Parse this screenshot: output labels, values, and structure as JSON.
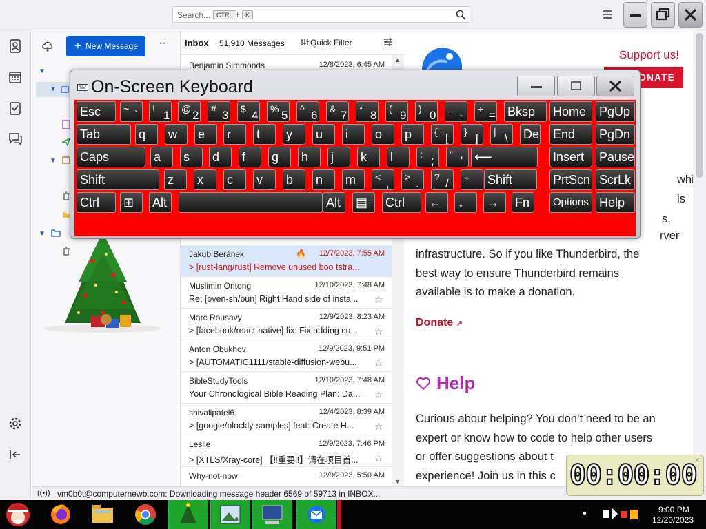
{
  "search": {
    "placeholder": "Search...",
    "kbd1": "CTRL",
    "plus": "+",
    "kbd2": "K"
  },
  "folder_pane": {
    "new_message": "New Message"
  },
  "list_header": {
    "title": "Inbox",
    "count": "51,910 Messages",
    "quick_filter": "Quick Filter"
  },
  "messages": [
    {
      "from": "Benjamin Simmonds",
      "date": "12/8/2023, 6:45 AM",
      "subject": ""
    },
    {
      "from": "Jakub Beránek",
      "date": "12/7/2023, 7:55 AM",
      "subject": "[rust-lang/rust] Remove unused boo tstra..."
    },
    {
      "from": "Muslimin Ontong",
      "date": "12/10/2023, 7:48 AM",
      "subject": "Re: [oven-sh/bun] Right Hand side of insta..."
    },
    {
      "from": "Marc Rousavy",
      "date": "12/9/2023, 8:23 AM",
      "subject": "[facebook/react-native] fix: Fix adding cu..."
    },
    {
      "from": "Anton Obukhov",
      "date": "12/9/2023, 9:51 PM",
      "subject": "[AUTOMATIC1111/stable-diffusion-webu..."
    },
    {
      "from": "BibleStudyTools",
      "date": "12/10/2023, 7:48 AM",
      "subject": "Your Chronological Bible Reading Plan: Da..."
    },
    {
      "from": "shivalipatel6",
      "date": "12/4/2023, 8:39 AM",
      "subject": "[google/blockly-samples] feat: Create H..."
    },
    {
      "from": "Leslie",
      "date": "12/9/2023, 7:46 PM",
      "subject": "[XTLS/Xray-core] 【‼重要‼】请在项目首..."
    },
    {
      "from": "Why-not-now",
      "date": "12/9/2023, 5:50 AM",
      "subject": ""
    }
  ],
  "content": {
    "support": "Support us!",
    "donate_button": "DONATE",
    "frag_which": "which is",
    "frag_s": "s,",
    "frag_rver": "rver",
    "para1": [
      "infrastructure. So if you like Thunderbird, the",
      "best way to ensure Thunderbird remains",
      "available is to make a donation."
    ],
    "donate_link": "Donate",
    "help_heading": "Help",
    "para2": [
      "Curious about helping? You don’t need to be an",
      "expert or know how to code to help other users",
      "or offer suggestions about t",
      "experience! Join us in this c"
    ]
  },
  "status": "vm0b0t@computernewb.com: Downloading message header 6569 of 59713 in INBOX...",
  "osk": {
    "title": "On-Screen Keyboard",
    "rows": [
      [
        {
          "l": "Esc"
        },
        {
          "t": "~",
          "b": "`"
        },
        {
          "t": "!",
          "b": "1"
        },
        {
          "t": "@",
          "b": "2"
        },
        {
          "t": "#",
          "b": "3"
        },
        {
          "t": "$",
          "b": "4"
        },
        {
          "t": "%",
          "b": "5"
        },
        {
          "t": "^",
          "b": "6"
        },
        {
          "t": "&",
          "b": "7"
        },
        {
          "t": "*",
          "b": "8"
        },
        {
          "t": "(",
          "b": "9"
        },
        {
          "t": ")",
          "b": "0"
        },
        {
          "t": "_",
          "b": "-"
        },
        {
          "t": "+",
          "b": "="
        },
        {
          "l": "Bksp"
        },
        {
          "l": "Home"
        },
        {
          "l": "PgUp"
        }
      ],
      [
        {
          "l": "Tab"
        },
        {
          "l": "q"
        },
        {
          "l": "w"
        },
        {
          "l": "e"
        },
        {
          "l": "r"
        },
        {
          "l": "t"
        },
        {
          "l": "y"
        },
        {
          "l": "u"
        },
        {
          "l": "i"
        },
        {
          "l": "o"
        },
        {
          "l": "p"
        },
        {
          "t": "{",
          "b": "["
        },
        {
          "t": "}",
          "b": "]"
        },
        {
          "t": "|",
          "b": "\\"
        },
        {
          "l": "Del"
        },
        {
          "l": "End"
        },
        {
          "l": "PgDn"
        }
      ],
      [
        {
          "l": "Caps"
        },
        {
          "l": "a"
        },
        {
          "l": "s"
        },
        {
          "l": "d"
        },
        {
          "l": "f"
        },
        {
          "l": "g"
        },
        {
          "l": "h"
        },
        {
          "l": "j"
        },
        {
          "l": "k"
        },
        {
          "l": "l"
        },
        {
          "t": ":",
          "b": ";"
        },
        {
          "t": "\"",
          "b": "'"
        },
        {
          "l": "⟵"
        },
        {
          "l": "Insert"
        },
        {
          "l": "Pause"
        }
      ],
      [
        {
          "l": "Shift"
        },
        {
          "l": "z"
        },
        {
          "l": "x"
        },
        {
          "l": "c"
        },
        {
          "l": "v"
        },
        {
          "l": "b"
        },
        {
          "l": "n"
        },
        {
          "l": "m"
        },
        {
          "t": "<",
          "b": ","
        },
        {
          "t": ">",
          "b": "."
        },
        {
          "t": "?",
          "b": "/"
        },
        {
          "l": "↑"
        },
        {
          "l": "Shift"
        },
        {
          "l": "PrtScn"
        },
        {
          "l": "ScrLk"
        }
      ],
      [
        {
          "l": "Ctrl"
        },
        {
          "l": "⊞"
        },
        {
          "l": "Alt"
        },
        {
          "l": ""
        },
        {
          "l": "Alt"
        },
        {
          "l": "▤"
        },
        {
          "l": "Ctrl"
        },
        {
          "l": "←"
        },
        {
          "l": "↓"
        },
        {
          "l": "→"
        },
        {
          "l": "Fn"
        },
        {
          "l": "Options"
        },
        {
          "l": "Help"
        }
      ]
    ]
  },
  "timer": "00:00:00",
  "clock": {
    "time": "9:00 PM",
    "date": "12/20/2023"
  }
}
